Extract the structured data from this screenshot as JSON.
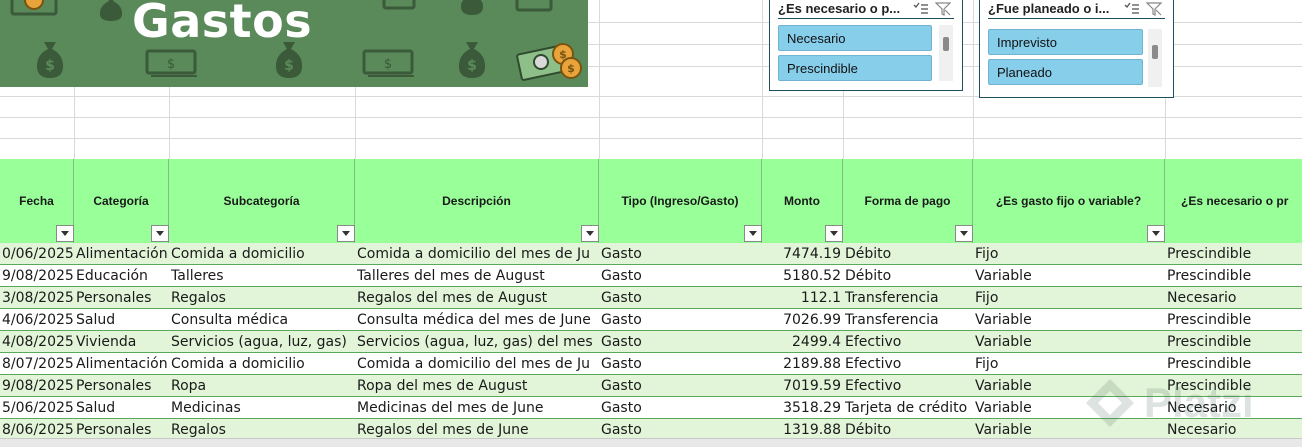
{
  "banner": {
    "title": "Gastos"
  },
  "slicers": [
    {
      "title": "¿Es necesario o p...",
      "items": [
        "Necesario",
        "Prescindible"
      ]
    },
    {
      "title": "¿Fue planeado o i...",
      "items": [
        "Imprevisto",
        "Planeado"
      ]
    }
  ],
  "columns": [
    "Fecha",
    "Categoría",
    "Subcategoría",
    "Descripción",
    "Tipo (Ingreso/Gasto)",
    "Monto",
    "Forma de pago",
    "¿Es gasto fijo o variable?",
    "¿Es necesario o pr"
  ],
  "rows": [
    [
      "0/06/2025",
      "Alimentación",
      "Comida a domicilio",
      "Comida a domicilio del mes de Ju",
      "Gasto",
      "7474.19",
      "Débito",
      "Fijo",
      "Prescindible"
    ],
    [
      "9/08/2025",
      "Educación",
      "Talleres",
      "Talleres del mes de August",
      "Gasto",
      "5180.52",
      "Débito",
      "Variable",
      "Prescindible"
    ],
    [
      "3/08/2025",
      "Personales",
      "Regalos",
      "Regalos del mes de August",
      "Gasto",
      "112.1",
      "Transferencia",
      "Fijo",
      "Necesario"
    ],
    [
      "4/06/2025",
      "Salud",
      "Consulta médica",
      "Consulta médica del mes de June",
      "Gasto",
      "7026.99",
      "Transferencia",
      "Variable",
      "Prescindible"
    ],
    [
      "4/08/2025",
      "Vivienda",
      "Servicios (agua, luz, gas)",
      "Servicios (agua, luz, gas) del mes",
      "Gasto",
      "2499.4",
      "Efectivo",
      "Variable",
      "Prescindible"
    ],
    [
      "8/07/2025",
      "Alimentación",
      "Comida a domicilio",
      "Comida a domicilio del mes de Ju",
      "Gasto",
      "2189.88",
      "Efectivo",
      "Fijo",
      "Prescindible"
    ],
    [
      "9/08/2025",
      "Personales",
      "Ropa",
      "Ropa del mes de August",
      "Gasto",
      "7019.59",
      "Efectivo",
      "Variable",
      "Prescindible"
    ],
    [
      "5/06/2025",
      "Salud",
      "Medicinas",
      "Medicinas del mes de June",
      "Gasto",
      "3518.29",
      "Tarjeta de crédito",
      "Variable",
      "Necesario"
    ],
    [
      "8/06/2025",
      "Personales",
      "Regalos",
      "Regalos del mes de June",
      "Gasto",
      "1319.88",
      "Débito",
      "Variable",
      "Necesario"
    ]
  ],
  "watermark": "Platzi",
  "colors": {
    "header": "#99ff99",
    "band": "#e2f5d9",
    "banner": "#5b8a5a",
    "slicer_item": "#87ceeb"
  }
}
